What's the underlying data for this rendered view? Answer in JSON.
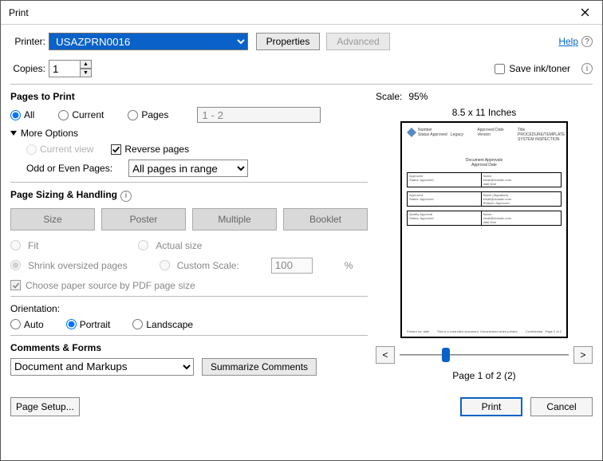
{
  "title": "Print",
  "help": "Help",
  "printer": {
    "label": "Printer:",
    "value": "USAZPRN0016",
    "properties": "Properties",
    "advanced": "Advanced"
  },
  "copies": {
    "label": "Copies:",
    "value": "1"
  },
  "saveInk": "Save ink/toner",
  "pagesToPrint": {
    "title": "Pages to Print",
    "all": "All",
    "current": "Current",
    "pagesLabel": "Pages",
    "pagesRange": "1 - 2",
    "moreOptions": "More Options",
    "currentView": "Current view",
    "reversePages": "Reverse pages",
    "oddEvenLabel": "Odd or Even Pages:",
    "oddEvenValue": "All pages in range"
  },
  "sizing": {
    "title": "Page Sizing & Handling",
    "size": "Size",
    "poster": "Poster",
    "multiple": "Multiple",
    "booklet": "Booklet",
    "fit": "Fit",
    "actual": "Actual size",
    "shrink": "Shrink oversized pages",
    "customScale": "Custom Scale:",
    "customValue": "100",
    "pct": "%",
    "paperSource": "Choose paper source by PDF page size"
  },
  "orientation": {
    "title": "Orientation:",
    "auto": "Auto",
    "portrait": "Portrait",
    "landscape": "Landscape"
  },
  "comments": {
    "title": "Comments & Forms",
    "value": "Document and Markups",
    "summarize": "Summarize Comments"
  },
  "preview": {
    "scaleLabel": "Scale:",
    "scaleValue": "95%",
    "paper": "8.5 x 11 Inches",
    "pageOf": "Page 1 of 2 (2)"
  },
  "buttons": {
    "pageSetup": "Page Setup...",
    "print": "Print",
    "cancel": "Cancel"
  }
}
